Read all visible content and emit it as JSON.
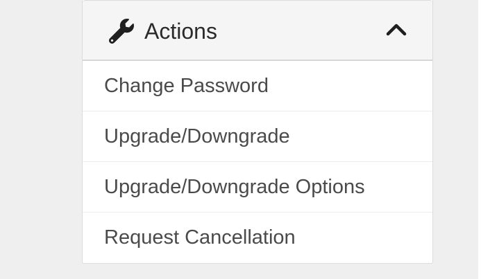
{
  "panel": {
    "title": "Actions",
    "title_icon": "wrench-icon",
    "collapse_icon": "chevron-up-icon"
  },
  "actions": [
    {
      "label": "Change Password"
    },
    {
      "label": "Upgrade/Downgrade"
    },
    {
      "label": "Upgrade/Downgrade Options"
    },
    {
      "label": "Request Cancellation"
    }
  ],
  "colors": {
    "page_background": "#efefef",
    "header_background": "#f5f5f5",
    "text": "#4a4a4a"
  }
}
